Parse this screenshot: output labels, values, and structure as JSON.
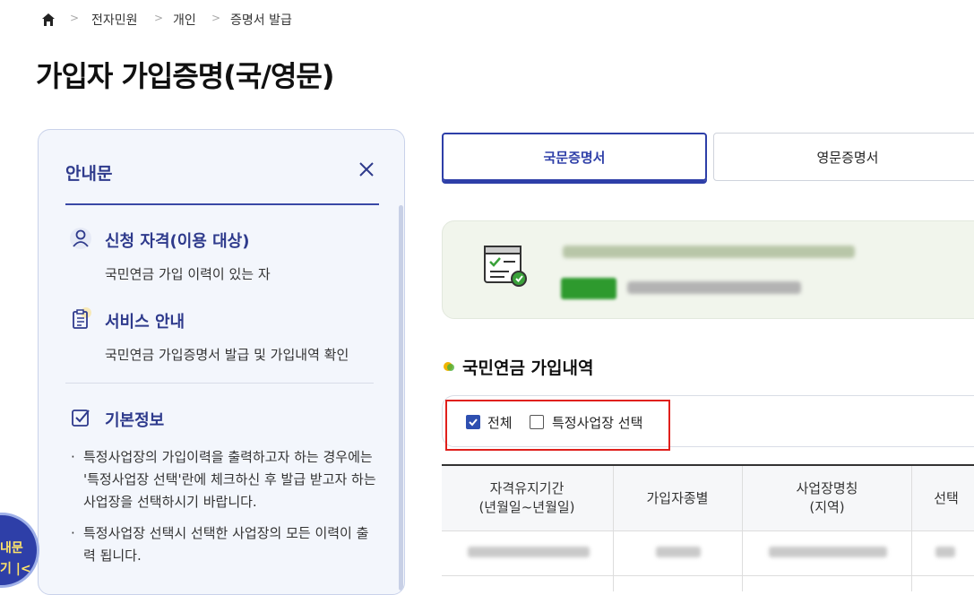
{
  "breadcrumb": {
    "home_icon": "home-icon",
    "items": [
      "전자민원",
      "개인",
      "증명서 발급"
    ]
  },
  "page_title": "가입자 가입증명(국/영문)",
  "guide": {
    "title": "안내문",
    "sections": [
      {
        "icon": "person-icon",
        "title": "신청 자격(이용 대상)",
        "body": "국민연금 가입 이력이 있는 자"
      },
      {
        "icon": "clipboard-icon",
        "title": "서비스 안내",
        "body": "국민연금 가입증명서 발급 및 가입내역 확인"
      },
      {
        "icon": "checkbox-icon",
        "title": "기본정보",
        "body": ""
      }
    ],
    "notes": [
      "특정사업장의 가입이력을 출력하고자 하는 경우에는 '특정사업장 선택'란에 체크하신 후 발급 받고자 하는 사업장을 선택하시기 바랍니다.",
      "특정사업장 선택시 선택한 사업장의 모든 이력이 출력 됩니다."
    ],
    "float_button": {
      "line1": "내문",
      "line2": "기 |<"
    }
  },
  "tabs": [
    {
      "label": "국문증명서",
      "active": true
    },
    {
      "label": "영문증명서",
      "active": false
    }
  ],
  "section_title": "국민연금 가입내역",
  "filter": {
    "all_label": "전체",
    "all_checked": true,
    "specific_label": "특정사업장 선택",
    "specific_checked": false
  },
  "table": {
    "headers": [
      {
        "line1": "자격유지기간",
        "line2": "(년월일~년월일)"
      },
      {
        "line1": "가입자종별",
        "line2": ""
      },
      {
        "line1": "사업장명칭",
        "line2": "(지역)"
      },
      {
        "line1": "선택",
        "line2": ""
      }
    ]
  },
  "colors": {
    "accent": "#2e3fa8",
    "highlight": "#e0201c",
    "banner_bg": "#f1f5ec"
  }
}
